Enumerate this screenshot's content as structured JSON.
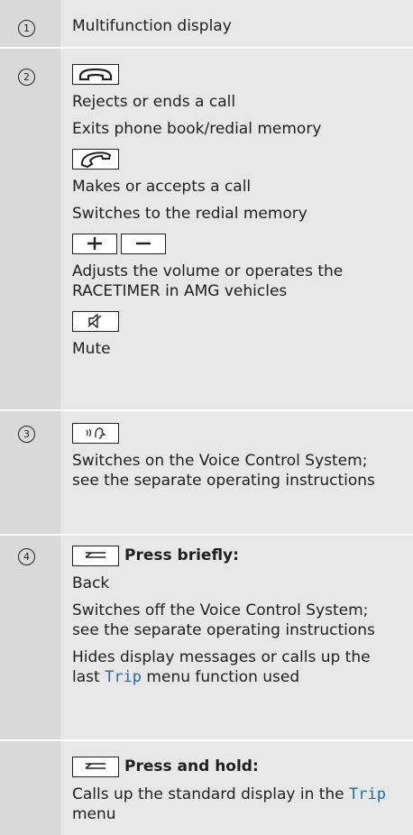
{
  "rows": [
    {
      "num": "1",
      "lines": [
        "Multifunction display"
      ]
    },
    {
      "num": "2",
      "end_call_icon": "phone-hangup-icon",
      "end_lines": [
        "Rejects or ends a call",
        "Exits phone book/redial memory"
      ],
      "accept_icon": "phone-handset-icon",
      "accept_lines": [
        "Makes or accepts a call",
        "Switches to the redial memory"
      ],
      "volume_icons": [
        "plus-icon",
        "minus-icon"
      ],
      "volume_lines": [
        "Adjusts the volume or operates the RACETIMER in AMG vehicles"
      ],
      "mute_icon": "mute-speaker-icon",
      "mute_lines": [
        "Mute"
      ]
    },
    {
      "num": "3",
      "voice_icon": "voice-control-icon",
      "lines": [
        "Switches on the Voice Control System; see the separate operating instructions"
      ]
    },
    {
      "num": "4",
      "back_icon": "back-arrow-icon",
      "heading": "Press briefly:",
      "lines": [
        "Back",
        "Switches off the Voice Control System; see the separate operating instructions"
      ],
      "trip_pre": "Hides display messages or calls up the last ",
      "trip_word": "Trip",
      "trip_post": " menu function used"
    },
    {
      "num": "",
      "back_icon": "back-arrow-icon",
      "heading": "Press and hold:",
      "trip_pre": "Calls up the standard display in the ",
      "trip_word": "Trip",
      "trip_post": " menu"
    }
  ],
  "colors": {
    "number_col": "#d9d9d9",
    "body_col": "#e7e7e7",
    "link": "#1b6ea8"
  }
}
